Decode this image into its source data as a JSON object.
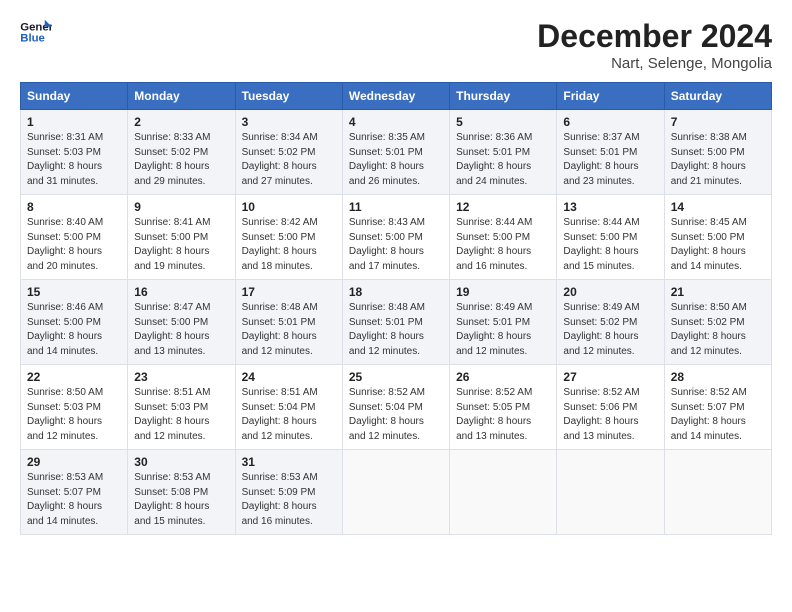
{
  "header": {
    "logo_line1": "General",
    "logo_line2": "Blue",
    "main_title": "December 2024",
    "subtitle": "Nart, Selenge, Mongolia"
  },
  "columns": [
    "Sunday",
    "Monday",
    "Tuesday",
    "Wednesday",
    "Thursday",
    "Friday",
    "Saturday"
  ],
  "weeks": [
    [
      {
        "day": "1",
        "sunrise": "Sunrise: 8:31 AM",
        "sunset": "Sunset: 5:03 PM",
        "daylight": "Daylight: 8 hours and 31 minutes."
      },
      {
        "day": "2",
        "sunrise": "Sunrise: 8:33 AM",
        "sunset": "Sunset: 5:02 PM",
        "daylight": "Daylight: 8 hours and 29 minutes."
      },
      {
        "day": "3",
        "sunrise": "Sunrise: 8:34 AM",
        "sunset": "Sunset: 5:02 PM",
        "daylight": "Daylight: 8 hours and 27 minutes."
      },
      {
        "day": "4",
        "sunrise": "Sunrise: 8:35 AM",
        "sunset": "Sunset: 5:01 PM",
        "daylight": "Daylight: 8 hours and 26 minutes."
      },
      {
        "day": "5",
        "sunrise": "Sunrise: 8:36 AM",
        "sunset": "Sunset: 5:01 PM",
        "daylight": "Daylight: 8 hours and 24 minutes."
      },
      {
        "day": "6",
        "sunrise": "Sunrise: 8:37 AM",
        "sunset": "Sunset: 5:01 PM",
        "daylight": "Daylight: 8 hours and 23 minutes."
      },
      {
        "day": "7",
        "sunrise": "Sunrise: 8:38 AM",
        "sunset": "Sunset: 5:00 PM",
        "daylight": "Daylight: 8 hours and 21 minutes."
      }
    ],
    [
      {
        "day": "8",
        "sunrise": "Sunrise: 8:40 AM",
        "sunset": "Sunset: 5:00 PM",
        "daylight": "Daylight: 8 hours and 20 minutes."
      },
      {
        "day": "9",
        "sunrise": "Sunrise: 8:41 AM",
        "sunset": "Sunset: 5:00 PM",
        "daylight": "Daylight: 8 hours and 19 minutes."
      },
      {
        "day": "10",
        "sunrise": "Sunrise: 8:42 AM",
        "sunset": "Sunset: 5:00 PM",
        "daylight": "Daylight: 8 hours and 18 minutes."
      },
      {
        "day": "11",
        "sunrise": "Sunrise: 8:43 AM",
        "sunset": "Sunset: 5:00 PM",
        "daylight": "Daylight: 8 hours and 17 minutes."
      },
      {
        "day": "12",
        "sunrise": "Sunrise: 8:44 AM",
        "sunset": "Sunset: 5:00 PM",
        "daylight": "Daylight: 8 hours and 16 minutes."
      },
      {
        "day": "13",
        "sunrise": "Sunrise: 8:44 AM",
        "sunset": "Sunset: 5:00 PM",
        "daylight": "Daylight: 8 hours and 15 minutes."
      },
      {
        "day": "14",
        "sunrise": "Sunrise: 8:45 AM",
        "sunset": "Sunset: 5:00 PM",
        "daylight": "Daylight: 8 hours and 14 minutes."
      }
    ],
    [
      {
        "day": "15",
        "sunrise": "Sunrise: 8:46 AM",
        "sunset": "Sunset: 5:00 PM",
        "daylight": "Daylight: 8 hours and 14 minutes."
      },
      {
        "day": "16",
        "sunrise": "Sunrise: 8:47 AM",
        "sunset": "Sunset: 5:00 PM",
        "daylight": "Daylight: 8 hours and 13 minutes."
      },
      {
        "day": "17",
        "sunrise": "Sunrise: 8:48 AM",
        "sunset": "Sunset: 5:01 PM",
        "daylight": "Daylight: 8 hours and 12 minutes."
      },
      {
        "day": "18",
        "sunrise": "Sunrise: 8:48 AM",
        "sunset": "Sunset: 5:01 PM",
        "daylight": "Daylight: 8 hours and 12 minutes."
      },
      {
        "day": "19",
        "sunrise": "Sunrise: 8:49 AM",
        "sunset": "Sunset: 5:01 PM",
        "daylight": "Daylight: 8 hours and 12 minutes."
      },
      {
        "day": "20",
        "sunrise": "Sunrise: 8:49 AM",
        "sunset": "Sunset: 5:02 PM",
        "daylight": "Daylight: 8 hours and 12 minutes."
      },
      {
        "day": "21",
        "sunrise": "Sunrise: 8:50 AM",
        "sunset": "Sunset: 5:02 PM",
        "daylight": "Daylight: 8 hours and 12 minutes."
      }
    ],
    [
      {
        "day": "22",
        "sunrise": "Sunrise: 8:50 AM",
        "sunset": "Sunset: 5:03 PM",
        "daylight": "Daylight: 8 hours and 12 minutes."
      },
      {
        "day": "23",
        "sunrise": "Sunrise: 8:51 AM",
        "sunset": "Sunset: 5:03 PM",
        "daylight": "Daylight: 8 hours and 12 minutes."
      },
      {
        "day": "24",
        "sunrise": "Sunrise: 8:51 AM",
        "sunset": "Sunset: 5:04 PM",
        "daylight": "Daylight: 8 hours and 12 minutes."
      },
      {
        "day": "25",
        "sunrise": "Sunrise: 8:52 AM",
        "sunset": "Sunset: 5:04 PM",
        "daylight": "Daylight: 8 hours and 12 minutes."
      },
      {
        "day": "26",
        "sunrise": "Sunrise: 8:52 AM",
        "sunset": "Sunset: 5:05 PM",
        "daylight": "Daylight: 8 hours and 13 minutes."
      },
      {
        "day": "27",
        "sunrise": "Sunrise: 8:52 AM",
        "sunset": "Sunset: 5:06 PM",
        "daylight": "Daylight: 8 hours and 13 minutes."
      },
      {
        "day": "28",
        "sunrise": "Sunrise: 8:52 AM",
        "sunset": "Sunset: 5:07 PM",
        "daylight": "Daylight: 8 hours and 14 minutes."
      }
    ],
    [
      {
        "day": "29",
        "sunrise": "Sunrise: 8:53 AM",
        "sunset": "Sunset: 5:07 PM",
        "daylight": "Daylight: 8 hours and 14 minutes."
      },
      {
        "day": "30",
        "sunrise": "Sunrise: 8:53 AM",
        "sunset": "Sunset: 5:08 PM",
        "daylight": "Daylight: 8 hours and 15 minutes."
      },
      {
        "day": "31",
        "sunrise": "Sunrise: 8:53 AM",
        "sunset": "Sunset: 5:09 PM",
        "daylight": "Daylight: 8 hours and 16 minutes."
      },
      null,
      null,
      null,
      null
    ]
  ]
}
